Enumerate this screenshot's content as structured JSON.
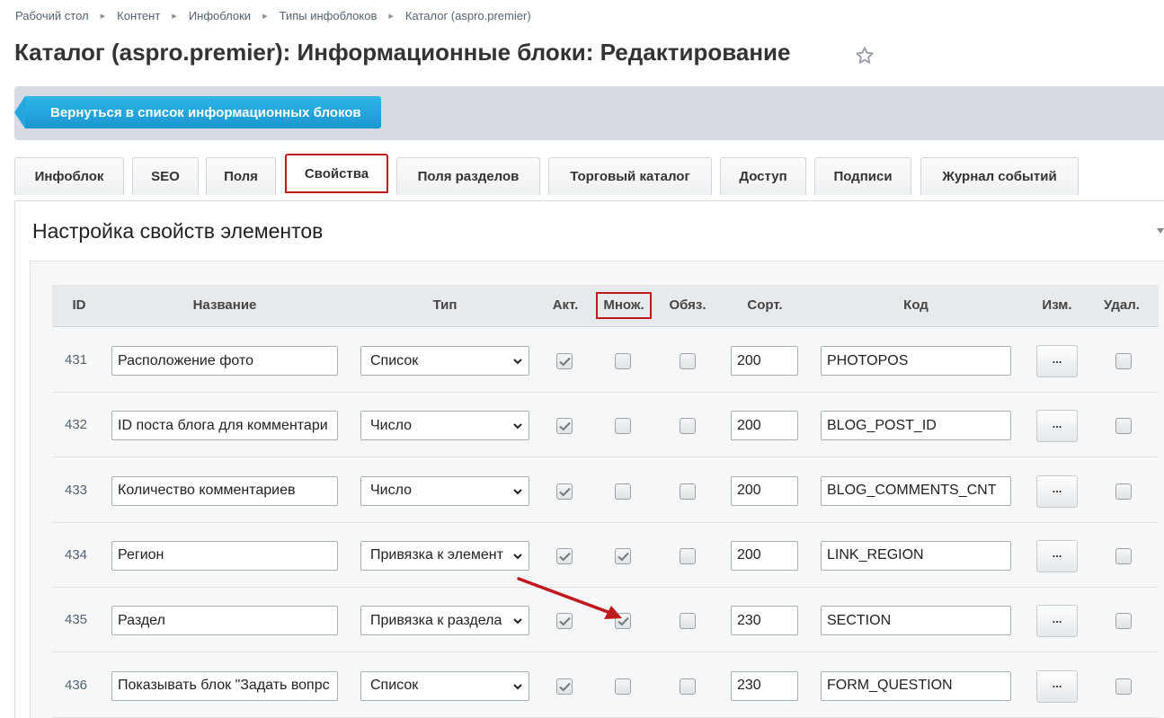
{
  "breadcrumb": [
    "Рабочий стол",
    "Контент",
    "Инфоблоки",
    "Типы инфоблоков",
    "Каталог (aspro.premier)"
  ],
  "page_title": "Каталог (aspro.premier): Информационные блоки: Редактирование",
  "toolbar": {
    "back_label": "Вернуться в список информационных блоков"
  },
  "tabs": [
    {
      "label": "Инфоблок"
    },
    {
      "label": "SEO"
    },
    {
      "label": "Поля"
    },
    {
      "label": "Свойства",
      "active": true
    },
    {
      "label": "Поля разделов"
    },
    {
      "label": "Торговый каталог"
    },
    {
      "label": "Доступ"
    },
    {
      "label": "Подписи"
    },
    {
      "label": "Журнал событий"
    }
  ],
  "section_title": "Настройка свойств элементов",
  "table": {
    "headers": {
      "id": "ID",
      "name": "Название",
      "type": "Тип",
      "active": "Акт.",
      "multiple": "Множ.",
      "required": "Обяз.",
      "sort": "Сорт.",
      "code": "Код",
      "edit": "Изм.",
      "delete": "Удал."
    },
    "edit_label": "...",
    "rows": [
      {
        "id": "431",
        "name": "Расположение фото",
        "type": "Список",
        "active": true,
        "multiple": false,
        "required": false,
        "sort": "200",
        "code": "PHOTOPOS",
        "delete": false
      },
      {
        "id": "432",
        "name": "ID поста блога для комментари",
        "type": "Число",
        "active": true,
        "multiple": false,
        "required": false,
        "sort": "200",
        "code": "BLOG_POST_ID",
        "delete": false
      },
      {
        "id": "433",
        "name": "Количество комментариев",
        "type": "Число",
        "active": true,
        "multiple": false,
        "required": false,
        "sort": "200",
        "code": "BLOG_COMMENTS_CNT",
        "delete": false
      },
      {
        "id": "434",
        "name": "Регион",
        "type": "Привязка к элемент",
        "active": true,
        "multiple": true,
        "required": false,
        "sort": "200",
        "code": "LINK_REGION",
        "delete": false
      },
      {
        "id": "435",
        "name": "Раздел",
        "type": "Привязка к раздела",
        "active": true,
        "multiple": true,
        "required": false,
        "sort": "230",
        "code": "SECTION",
        "delete": false
      },
      {
        "id": "436",
        "name": "Показывать блок \"Задать вопрс",
        "type": "Список",
        "active": true,
        "multiple": false,
        "required": false,
        "sort": "230",
        "code": "FORM_QUESTION",
        "delete": false
      }
    ]
  },
  "colors": {
    "accent": "#1c96cf",
    "highlight": "#c0181f",
    "toolbar_bg": "#d5dbe0"
  }
}
